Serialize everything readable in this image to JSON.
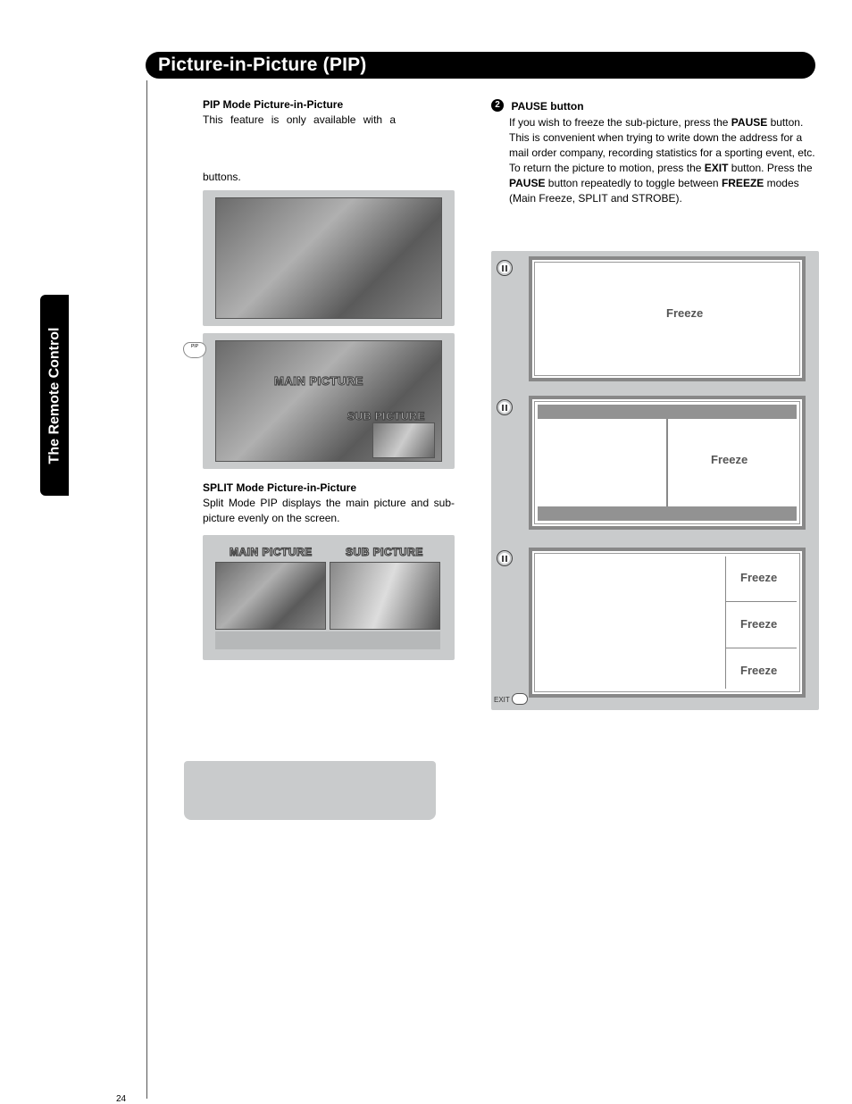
{
  "page": {
    "title": "Picture-in-Picture (PIP)",
    "sideTab": "The Remote Control",
    "pageNumber": "24"
  },
  "left": {
    "pipModeHeading": "PIP Mode Picture-in-Picture",
    "pipModeLine1": "This feature is only available with a",
    "buttonsWord": "buttons.",
    "pipBtnLabel": "PIP",
    "mainPictureLabel": "MAIN PICTURE",
    "subPictureLabel": "SUB PICTURE",
    "splitHeading": "SPLIT Mode Picture-in-Picture",
    "splitBody": "Split Mode PIP displays the main picture and sub-picture evenly on the screen.",
    "splitMainLabel": "MAIN PICTURE",
    "splitSubLabel": "SUB PICTURE"
  },
  "right": {
    "stepNumber": "2",
    "pauseHeading": "PAUSE button",
    "pauseBody1": "If you wish to freeze the sub-picture, press the ",
    "pauseBold1": "PAUSE",
    "pauseBody2": " button. This is convenient when trying to write down the address for a mail order company, recording statistics for a sporting event, etc. To return the picture to motion, press the ",
    "pauseBold2": "EXIT",
    "pauseBody3": " button. Press the ",
    "pauseBold3": "PAUSE",
    "pauseBody4": " button repeatedly to toggle between ",
    "pauseBold4": "FREEZE",
    "pauseBody5": " modes (Main Freeze, SPLIT and STROBE).",
    "freezeLabel": "Freeze",
    "exitLabel": "EXIT"
  }
}
